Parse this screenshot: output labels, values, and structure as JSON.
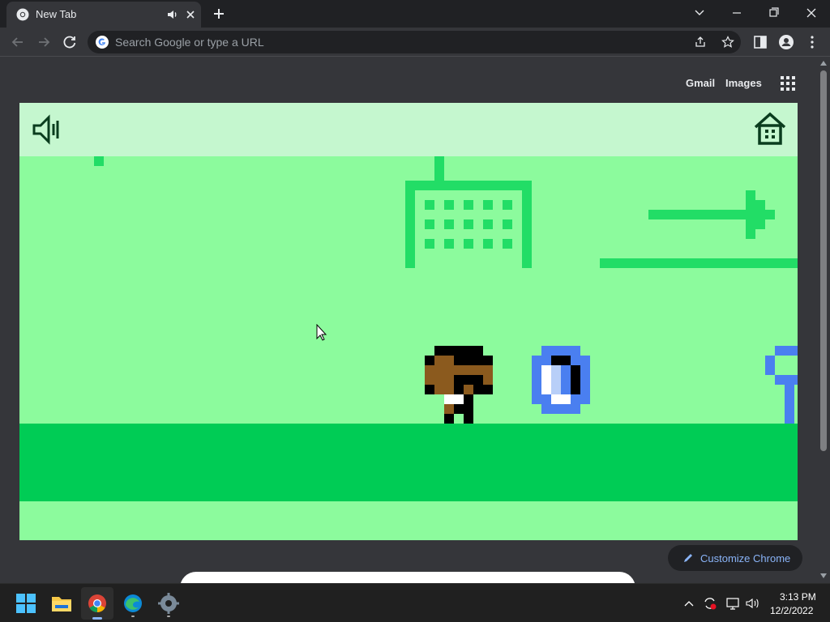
{
  "browser": {
    "tab_title": "New Tab",
    "omnibox_placeholder": "Search Google or type a URL"
  },
  "page": {
    "gmail_label": "Gmail",
    "images_label": "Images",
    "customize_label": "Customize Chrome"
  },
  "game": {
    "sound_icon": "speaker-icon",
    "home_icon": "house-icon",
    "colors": {
      "sky": "#8cfb9d",
      "header": "#c5f7cf",
      "ground": "#00cc55",
      "deco": "#22dd66",
      "player_skin": "#8b5a1e",
      "gem": "#4a7ff0"
    }
  },
  "taskbar": {
    "time": "3:13 PM",
    "date": "12/2/2022",
    "apps": [
      "start-icon",
      "file-explorer-icon",
      "chrome-icon",
      "edge-icon",
      "settings-icon"
    ]
  }
}
